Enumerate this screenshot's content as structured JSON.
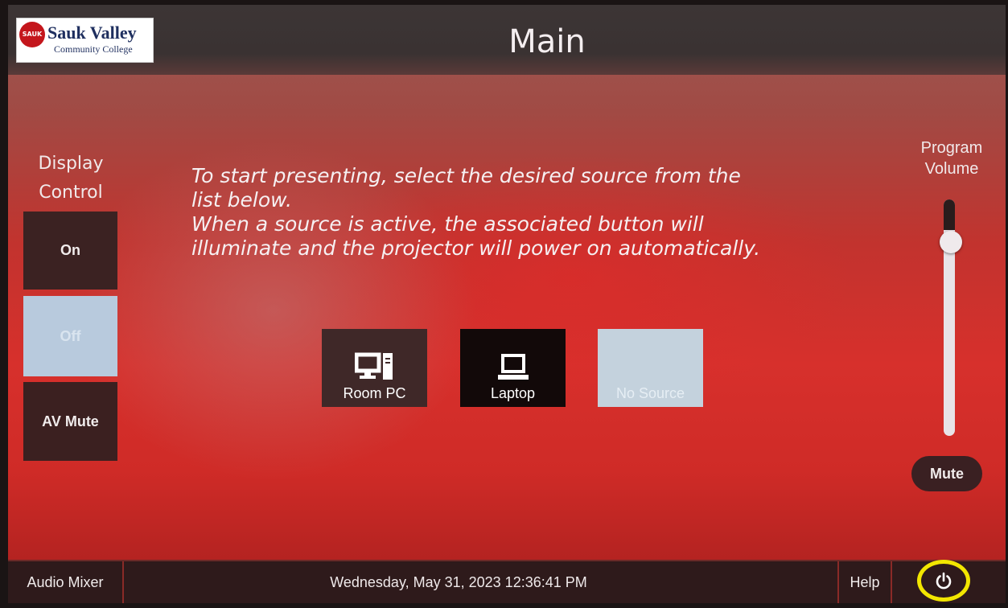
{
  "header": {
    "title": "Main",
    "logo": {
      "name": "Sauk Valley",
      "sub": "Community College",
      "mark": "SAUK"
    }
  },
  "display_control": {
    "label_line1": "Display",
    "label_line2": "Control",
    "on_label": "On",
    "off_label": "Off",
    "av_mute_label": "AV Mute"
  },
  "instructions": {
    "line1": "To start presenting, select the desired source from the",
    "line2": "list below.",
    "line3": "When a source is active, the associated button will",
    "line4": "illuminate and the projector will power on automatically."
  },
  "sources": {
    "room_pc_label": "Room PC",
    "room_pc_icon": "desktop-computer-icon",
    "laptop_label": "Laptop",
    "laptop_icon": "laptop-icon",
    "none_label": "No Source"
  },
  "volume": {
    "label_line1": "Program",
    "label_line2": "Volume",
    "level": 0.87,
    "mute_label": "Mute"
  },
  "footer": {
    "audio_mixer_label": "Audio Mixer",
    "datetime": "Wednesday, May 31, 2023 12:36:41 PM",
    "help_label": "Help",
    "power_icon": "power-icon"
  },
  "colors": {
    "accent_red": "#d7302c",
    "highlight_ring": "#f2e600",
    "selected_off": "#b8cadd"
  }
}
